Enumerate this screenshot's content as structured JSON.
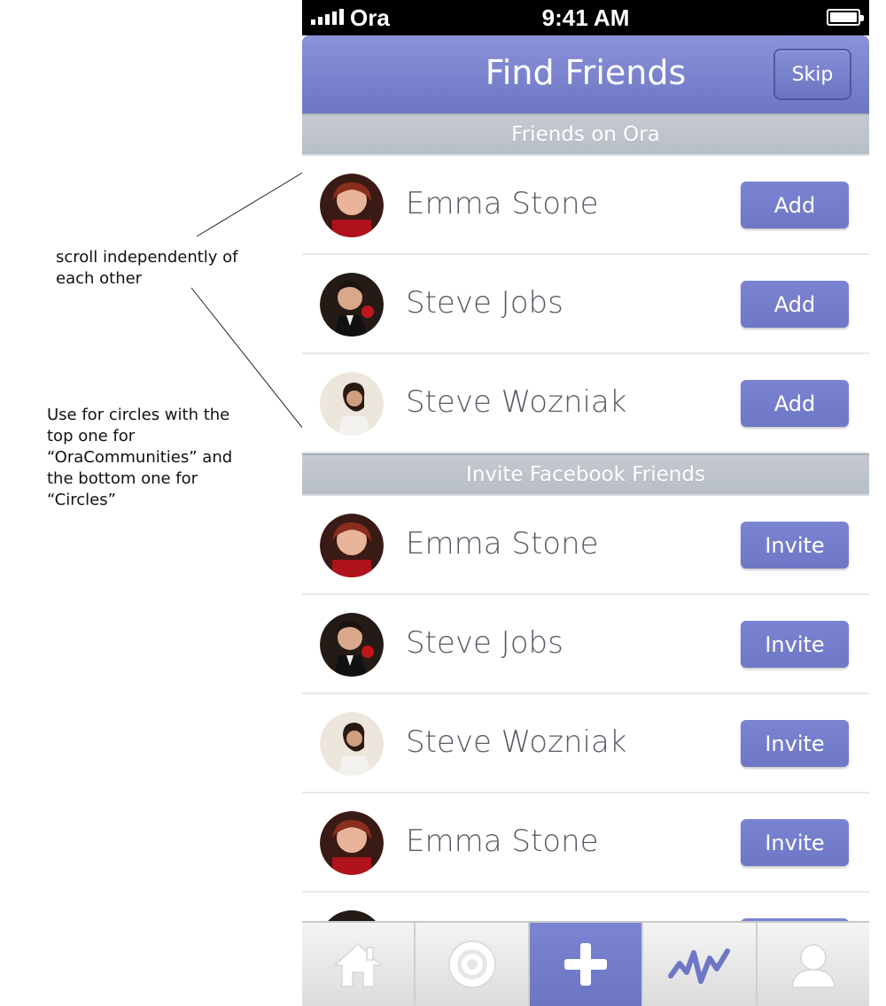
{
  "annotations": {
    "note_1": "scroll independently of\neach other",
    "note_2": "Use for circles with the\ntop one for\n“OraCommunities” and\nthe bottom one for\n“Circles”"
  },
  "status_bar": {
    "carrier": "Ora",
    "time": "9:41 AM"
  },
  "nav_bar": {
    "title": "Find Friends",
    "skip_label": "Skip"
  },
  "sections": {
    "friends_on_ora": "Friends on Ora",
    "invite_facebook": "Invite Facebook Friends"
  },
  "friends_on_ora": [
    {
      "name": "Emma Stone",
      "action": "Add",
      "avatar": "emma"
    },
    {
      "name": "Steve Jobs",
      "action": "Add",
      "avatar": "jobs"
    },
    {
      "name": "Steve Wozniak",
      "action": "Add",
      "avatar": "woz"
    }
  ],
  "facebook_friends": [
    {
      "name": "Emma Stone",
      "action": "Invite",
      "avatar": "emma"
    },
    {
      "name": "Steve Jobs",
      "action": "Invite",
      "avatar": "jobs"
    },
    {
      "name": "Steve Wozniak",
      "action": "Invite",
      "avatar": "woz"
    },
    {
      "name": "Emma Stone",
      "action": "Invite",
      "avatar": "emma"
    }
  ],
  "tabs": [
    {
      "icon": "home-icon",
      "active": false
    },
    {
      "icon": "target-circles-icon",
      "active": false
    },
    {
      "icon": "plus-icon",
      "active": true
    },
    {
      "icon": "activity-wave-icon",
      "active": false
    },
    {
      "icon": "profile-icon",
      "active": false
    }
  ],
  "colors": {
    "accent": "#7580cc",
    "section_header": "#bfc4cb",
    "name_text": "#5a5a66"
  }
}
